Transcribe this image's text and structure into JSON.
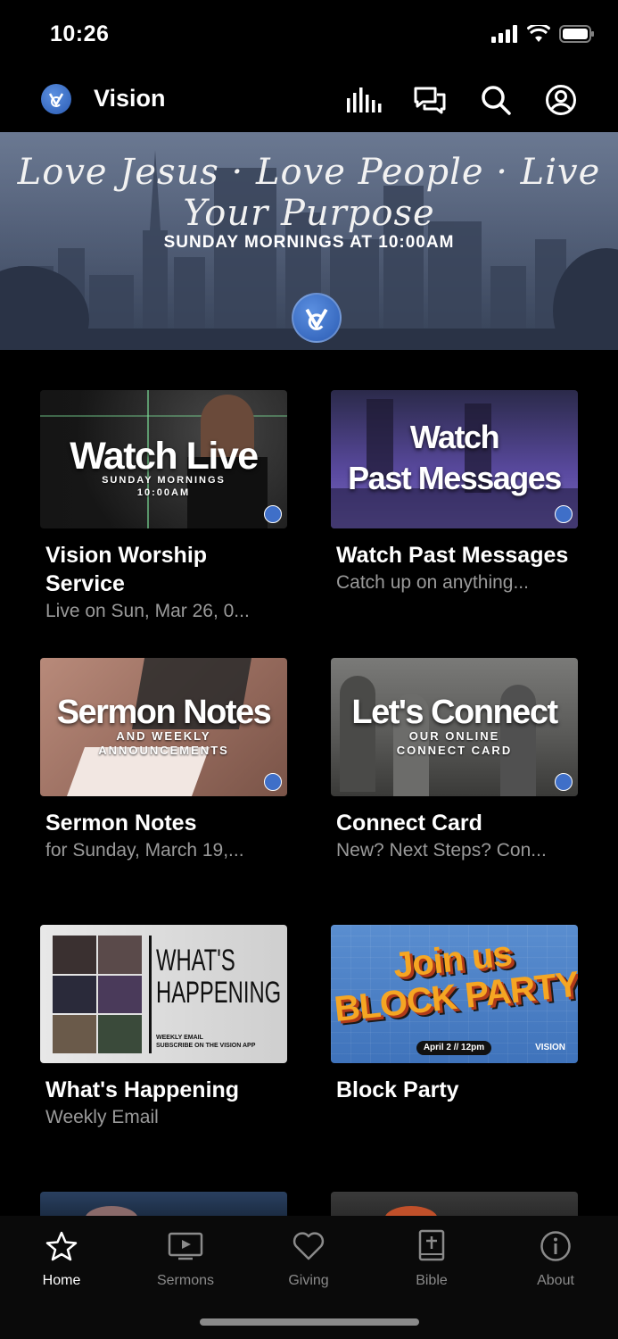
{
  "status": {
    "time": "10:26"
  },
  "header": {
    "app_title": "Vision",
    "icons": [
      "audio-icon",
      "chat-icon",
      "search-icon",
      "profile-icon"
    ]
  },
  "hero": {
    "script_text": "Love Jesus · Love People · Live Your Purpose",
    "subtitle": "SUNDAY MORNINGS AT 10:00AM"
  },
  "cards": [
    {
      "thumb_title": "Watch Live",
      "thumb_sub": "SUNDAY MORNINGS\n10:00AM",
      "title": "Vision Worship Service",
      "subtitle": "Live on Sun, Mar 26, 0..."
    },
    {
      "thumb_title": "Watch\nPast Messages",
      "thumb_sub": "",
      "title": "Watch Past Messages",
      "subtitle": "Catch up on anything..."
    },
    {
      "thumb_title": "Sermon Notes",
      "thumb_sub": "AND WEEKLY\nANNOUNCEMENTS",
      "title": "Sermon Notes",
      "subtitle": "for Sunday, March 19,..."
    },
    {
      "thumb_title": "Let's Connect",
      "thumb_sub": "OUR ONLINE\nCONNECT CARD",
      "title": "Connect Card",
      "subtitle": "New? Next Steps? Con..."
    },
    {
      "thumb_title": "WHAT'S HAPPENING",
      "thumb_sub": "WEEKLY EMAIL\nSUBSCRIBE ON THE VISION APP",
      "title": "What's Happening",
      "subtitle": "Weekly Email"
    },
    {
      "thumb_title": "Join us BLOCK PARTY",
      "thumb_sub": "April 2 // 12pm",
      "thumb_brand": "VISION",
      "title": "Block Party",
      "subtitle": ""
    }
  ],
  "tabs": [
    {
      "label": "Home",
      "icon": "star-icon",
      "active": true
    },
    {
      "label": "Sermons",
      "icon": "tv-icon",
      "active": false
    },
    {
      "label": "Giving",
      "icon": "heart-icon",
      "active": false
    },
    {
      "label": "Bible",
      "icon": "bible-icon",
      "active": false
    },
    {
      "label": "About",
      "icon": "info-icon",
      "active": false
    }
  ],
  "colors": {
    "background": "#000000",
    "accent": "#3f6fc8",
    "muted_text": "#9a9a9a"
  }
}
